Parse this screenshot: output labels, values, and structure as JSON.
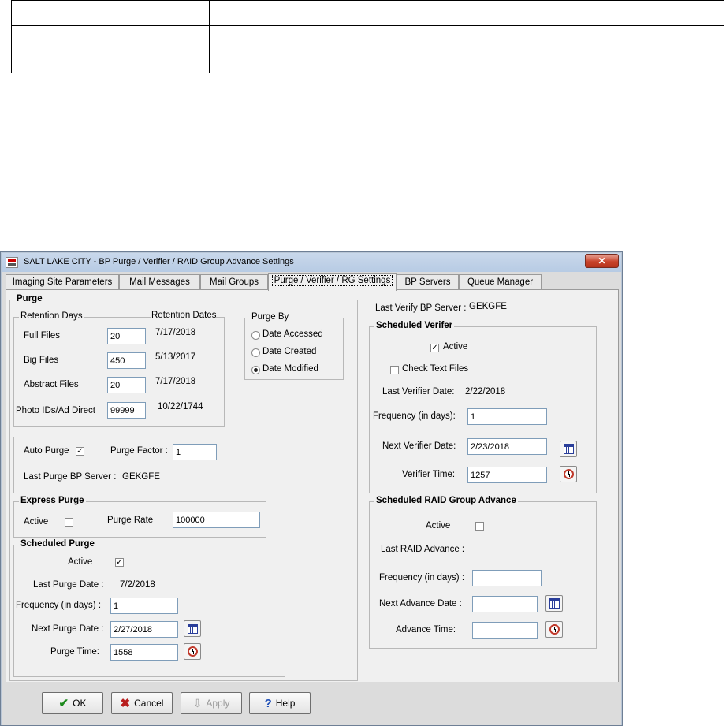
{
  "window": {
    "title": "SALT LAKE CITY - BP Purge / Verifier / RAID Group Advance Settings",
    "close_glyph": "✕"
  },
  "tabs": [
    {
      "label": "Imaging Site Parameters"
    },
    {
      "label": "Mail Messages"
    },
    {
      "label": "Mail Groups"
    },
    {
      "label": "Purge / Verifier / RG Settings"
    },
    {
      "label": "BP Servers"
    },
    {
      "label": "Queue Manager"
    }
  ],
  "purge": {
    "title": "Purge",
    "retention": {
      "days_title": "Retention Days",
      "dates_header": "Retention Dates",
      "rows": [
        {
          "label": "Full Files",
          "value": "20",
          "date": "7/17/2018"
        },
        {
          "label": "Big Files",
          "value": "450",
          "date": "5/13/2017"
        },
        {
          "label": "Abstract Files",
          "value": "20",
          "date": "7/17/2018"
        },
        {
          "label": "Photo IDs/Ad Direct",
          "value": "99999",
          "date": "10/22/1744"
        }
      ]
    },
    "purge_by": {
      "title": "Purge By",
      "options": [
        "Date Accessed",
        "Date Created",
        "Date Modified"
      ],
      "selected": "Date Modified"
    },
    "auto": {
      "label": "Auto Purge",
      "checked": true,
      "factor_label": "Purge Factor :",
      "factor_value": "1",
      "server_label": "Last Purge BP Server :",
      "server_value": "GEKGFE"
    },
    "express": {
      "title": "Express Purge",
      "active_label": "Active",
      "active_checked": false,
      "rate_label": "Purge Rate",
      "rate_value": "100000"
    },
    "scheduled": {
      "title": "Scheduled Purge",
      "active_label": "Active",
      "active_checked": true,
      "last_date_label": "Last Purge Date :",
      "last_date_value": "7/2/2018",
      "frequency_label": "Frequency (in days) :",
      "frequency_value": "1",
      "next_date_label": "Next Purge Date :",
      "next_date_value": "2/27/2018",
      "time_label": "Purge Time:",
      "time_value": "1558"
    }
  },
  "verifier": {
    "last_server_label": "Last Verify BP Server :",
    "last_server_value": "GEKGFE",
    "title": "Scheduled Verifer",
    "active_label": "Active",
    "active_checked": true,
    "check_text_label": "Check Text Files",
    "check_text_checked": false,
    "last_date_label": "Last Verifier Date:",
    "last_date_value": "2/22/2018",
    "frequency_label": "Frequency (in days):",
    "frequency_value": "1",
    "next_date_label": "Next Verifier Date:",
    "next_date_value": "2/23/2018",
    "time_label": "Verifier Time:",
    "time_value": "1257"
  },
  "raid": {
    "title": "Scheduled RAID Group Advance",
    "active_label": "Active",
    "active_checked": false,
    "last_label": "Last RAID Advance :",
    "frequency_label": "Frequency (in days) :",
    "frequency_value": "",
    "next_date_label": "Next Advance Date :",
    "next_date_value": "",
    "time_label": "Advance Time:",
    "time_value": ""
  },
  "buttons": {
    "ok": {
      "glyph": "✔",
      "label": "OK"
    },
    "cancel": {
      "glyph": "✖",
      "label": "Cancel"
    },
    "apply": {
      "glyph": "⇩",
      "label": "Apply"
    },
    "help": {
      "glyph": "?",
      "label": "Help"
    }
  },
  "check_glyph": "✓"
}
